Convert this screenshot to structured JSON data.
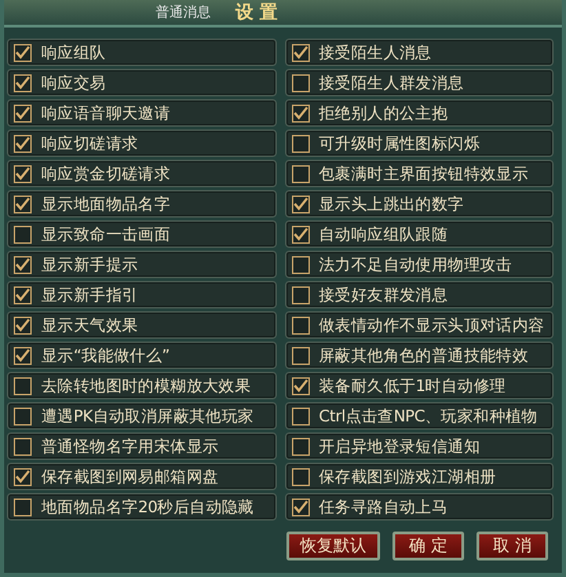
{
  "header": {
    "tab": "普通消息",
    "title": "设 置"
  },
  "options": [
    {
      "label": "响应组队",
      "checked": true
    },
    {
      "label": "接受陌生人消息",
      "checked": true
    },
    {
      "label": "响应交易",
      "checked": true
    },
    {
      "label": "接受陌生人群发消息",
      "checked": false
    },
    {
      "label": "响应语音聊天邀请",
      "checked": true
    },
    {
      "label": "拒绝别人的公主抱",
      "checked": true
    },
    {
      "label": "响应切磋请求",
      "checked": true
    },
    {
      "label": "可升级时属性图标闪烁",
      "checked": false
    },
    {
      "label": "响应赏金切磋请求",
      "checked": true
    },
    {
      "label": "包裹满时主界面按钮特效显示",
      "checked": false
    },
    {
      "label": "显示地面物品名字",
      "checked": true
    },
    {
      "label": "显示头上跳出的数字",
      "checked": true
    },
    {
      "label": "显示致命一击画面",
      "checked": false
    },
    {
      "label": "自动响应组队跟随",
      "checked": true
    },
    {
      "label": "显示新手提示",
      "checked": true
    },
    {
      "label": "法力不足自动使用物理攻击",
      "checked": false
    },
    {
      "label": "显示新手指引",
      "checked": true
    },
    {
      "label": "接受好友群发消息",
      "checked": false
    },
    {
      "label": "显示天气效果",
      "checked": true
    },
    {
      "label": "做表情动作不显示头顶对话内容",
      "checked": false
    },
    {
      "label": "显示“我能做什么”",
      "checked": true
    },
    {
      "label": "屏蔽其他角色的普通技能特效",
      "checked": false
    },
    {
      "label": "去除转地图时的模糊放大效果",
      "checked": false
    },
    {
      "label": "装备耐久低于1时自动修理",
      "checked": true
    },
    {
      "label": "遭遇PK自动取消屏蔽其他玩家",
      "checked": false
    },
    {
      "label": "Ctrl点击查NPC、玩家和种植物",
      "checked": false
    },
    {
      "label": "普通怪物名字用宋体显示",
      "checked": false
    },
    {
      "label": "开启异地登录短信通知",
      "checked": false
    },
    {
      "label": "保存截图到网易邮箱网盘",
      "checked": true
    },
    {
      "label": "保存截图到游戏江湖相册",
      "checked": false
    },
    {
      "label": "地面物品名字20秒后自动隐藏",
      "checked": false
    },
    {
      "label": "任务寻路自动上马",
      "checked": true
    }
  ],
  "buttons": [
    "恢复默认",
    "确 定",
    "取 消"
  ]
}
